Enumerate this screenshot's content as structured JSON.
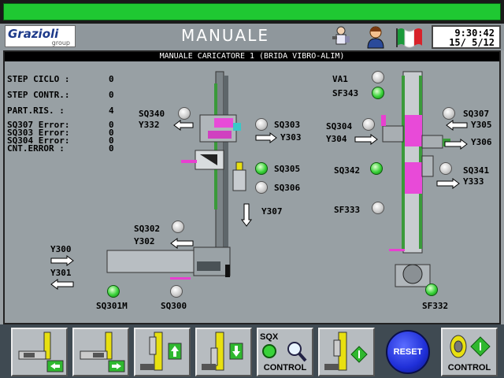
{
  "header": {
    "logo_name": "Grazioli",
    "logo_sub": "group",
    "title": "MANUALE",
    "clock_time": "9:30:42",
    "clock_date": "15/ 5/12"
  },
  "panel": {
    "subtitle": "MANUALE CARICATORE 1 (BRIDA VIBRO-ALIM)",
    "status": [
      {
        "label": "STEP CICLO :",
        "value": "0"
      },
      {
        "label": "STEP CONTR.:",
        "value": "0"
      },
      {
        "label": "PART.RIS. :",
        "value": "4"
      }
    ],
    "errors": [
      {
        "label": "SQ307 Error:",
        "value": "0"
      },
      {
        "label": "SQ303 Error:",
        "value": "0"
      },
      {
        "label": "SQ304 Error:",
        "value": "0"
      },
      {
        "label": "CNT.ERROR :",
        "value": "0"
      }
    ],
    "left_unit": {
      "sq340": "SQ340",
      "y332": "Y332",
      "sq303": "SQ303",
      "y303": "Y303",
      "sq305": "SQ305",
      "sq306": "SQ306",
      "y307": "Y307",
      "sq302": "SQ302",
      "y302": "Y302",
      "y300": "Y300",
      "y301": "Y301",
      "sq301m": "SQ301M",
      "sq300": "SQ300"
    },
    "right_unit": {
      "va1": "VA1",
      "sf343": "SF343",
      "sq307": "SQ307",
      "y305": "Y305",
      "sq304": "SQ304",
      "y304": "Y304",
      "y306": "Y306",
      "sq342": "SQ342",
      "sq341": "SQ341",
      "y333": "Y333",
      "sf333": "SF333",
      "sf332": "SF332"
    }
  },
  "buttons": {
    "sqx_label": "SQX",
    "control_label": "CONTROL",
    "reset_label": "RESET",
    "control2_label": "CONTROL"
  },
  "colors": {
    "lamp_on": "#39d239",
    "lamp_off": "#c8c8c8",
    "reset_blue": "#1f2fd8",
    "top_green": "#1fc832"
  }
}
